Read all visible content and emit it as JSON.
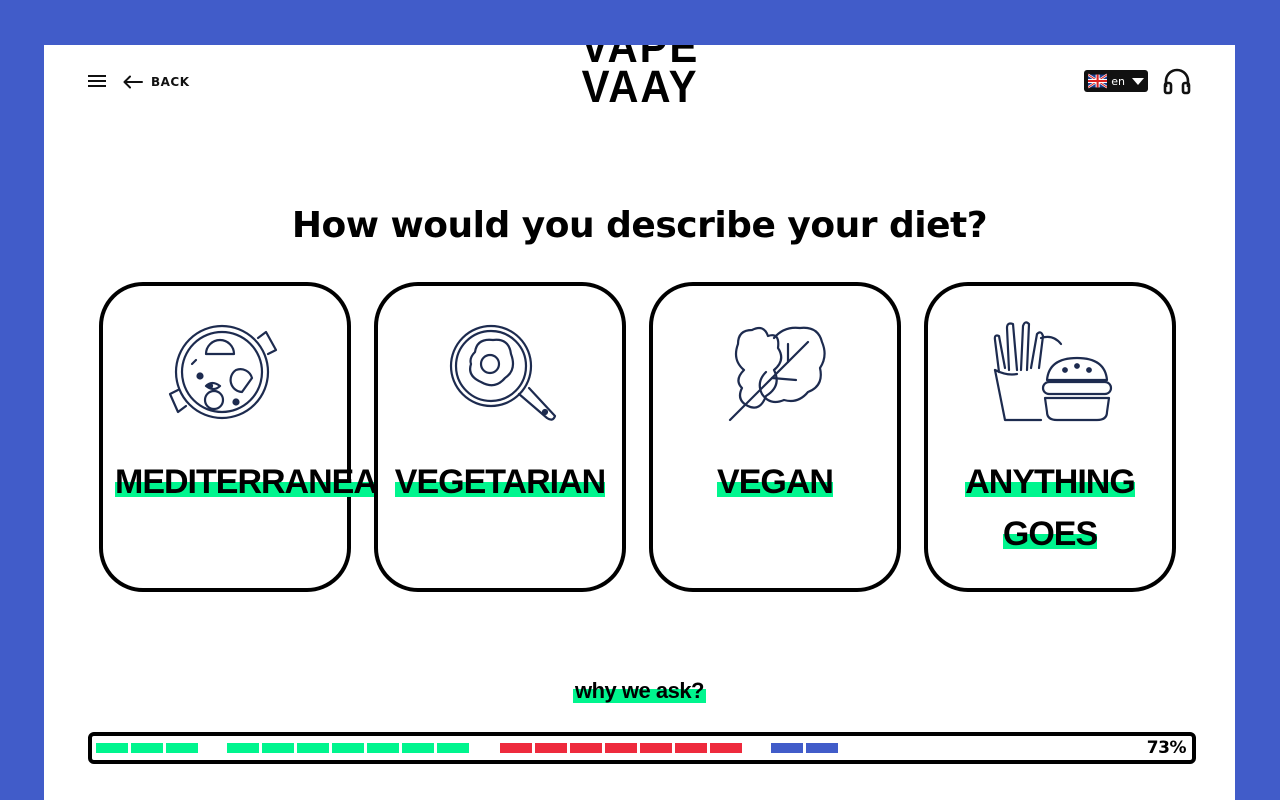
{
  "header": {
    "back_label": "BACK",
    "logo_line1": "VAPE",
    "logo_line2": "VAAY",
    "language": "en"
  },
  "question": "How would you describe your diet?",
  "options": [
    {
      "label": "MEDITERRANEAN",
      "icon": "paella-pan-icon"
    },
    {
      "label": "VEGETARIAN",
      "icon": "fried-egg-pan-icon"
    },
    {
      "label": "VEGAN",
      "icon": "leaves-icon"
    },
    {
      "label": "ANYTHING GOES",
      "icon": "fries-burger-icon"
    }
  ],
  "why_label": "why we ask?",
  "progress": {
    "percent_label": "73%",
    "value": 0.73,
    "colors": {
      "green": "#00f58e",
      "red": "#ee2a3d",
      "blue": "#415cc9"
    }
  },
  "colors": {
    "background": "#415cc9",
    "accent": "#00f58e"
  }
}
